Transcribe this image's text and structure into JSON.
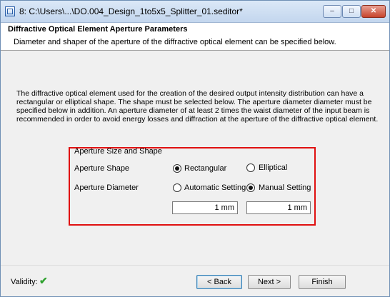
{
  "window": {
    "title": "8: C:\\Users\\...\\DO.004_Design_1to5x5_Splitter_01.seditor*",
    "controls": {
      "minimize": "–",
      "maximize": "□",
      "close": "✕"
    }
  },
  "header": {
    "title": "Diffractive Optical Element Aperture Parameters",
    "subtitle": "Diameter and shaper of the aperture of the diffractive optical element can be specified below."
  },
  "description": "The diffractive optical element used for the creation of the desired output intensity distribution can have a rectangular or elliptical shape. The shape must be selected below. The aperture diameter diameter must be specified below in addition. An aperture diameter of at least 2 times the waist diameter of the input beam is recommended in order to avoid energy losses and diffraction at the aperture of the diffractive optical element.",
  "aperture": {
    "group_title": "Aperture Size and Shape",
    "shape_label": "Aperture Shape",
    "shape_options": [
      {
        "label": "Rectangular",
        "selected": true
      },
      {
        "label": "Elliptical",
        "selected": false
      }
    ],
    "diameter_label": "Aperture Diameter",
    "diameter_options": [
      {
        "label": "Automatic Setting",
        "selected": false
      },
      {
        "label": "Manual Setting",
        "selected": true
      }
    ],
    "diameter_x": "1 mm",
    "diameter_y": "1 mm"
  },
  "footer": {
    "validity_label": "Validity:",
    "validity_icon": "check-icon",
    "back_label": "< Back",
    "next_label": "Next >",
    "finish_label": "Finish"
  }
}
